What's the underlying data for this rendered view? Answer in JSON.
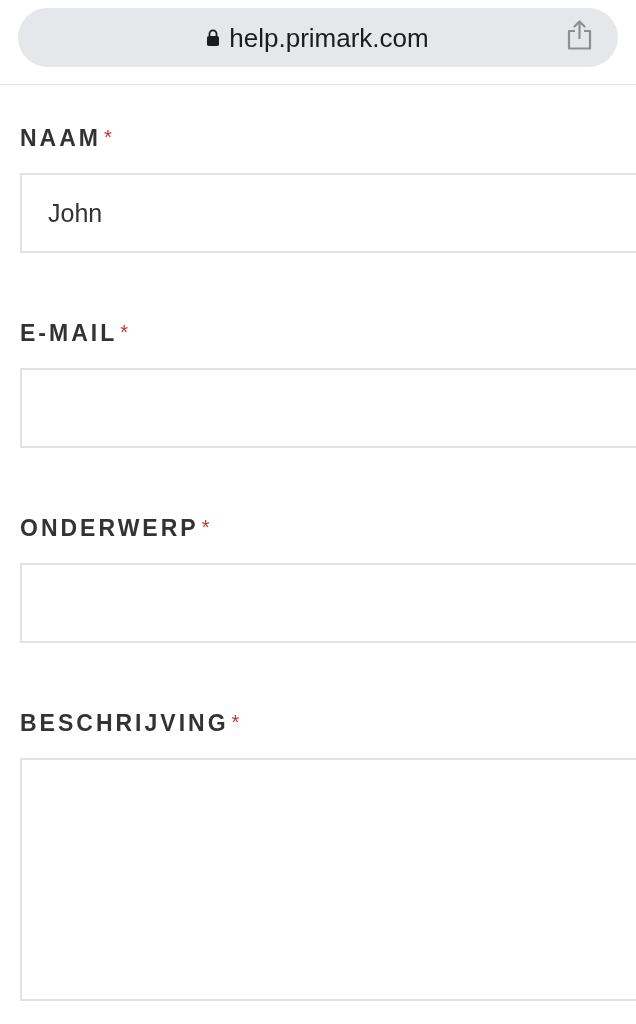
{
  "browser": {
    "url": "help.primark.com",
    "secure": true
  },
  "form": {
    "fields": [
      {
        "kind": "input",
        "label": "NAAM",
        "required_mark": "*",
        "value": "John"
      },
      {
        "kind": "input",
        "label": "E-MAIL",
        "required_mark": "*"
      },
      {
        "kind": "input",
        "label": "ONDERWERP",
        "required_mark": "*"
      },
      {
        "kind": "textarea",
        "label": "BESCHRIJVING",
        "required_mark": "*"
      }
    ]
  }
}
